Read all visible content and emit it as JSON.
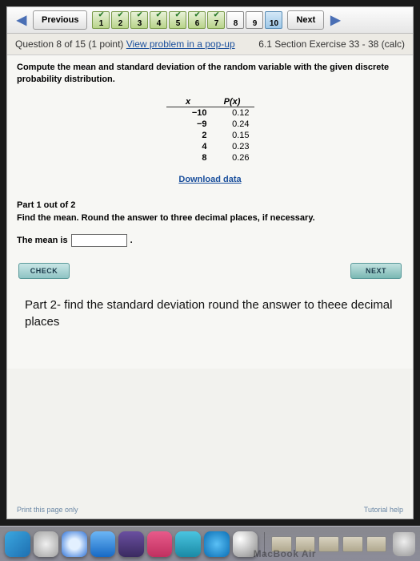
{
  "nav": {
    "prev": "Previous",
    "next": "Next",
    "items": [
      {
        "n": "1",
        "state": "done"
      },
      {
        "n": "2",
        "state": "done"
      },
      {
        "n": "3",
        "state": "done"
      },
      {
        "n": "4",
        "state": "done"
      },
      {
        "n": "5",
        "state": "done"
      },
      {
        "n": "6",
        "state": "done"
      },
      {
        "n": "7",
        "state": "done"
      },
      {
        "n": "8",
        "state": "current"
      },
      {
        "n": "9",
        "state": "plain"
      },
      {
        "n": "10",
        "state": "last"
      }
    ]
  },
  "meta": {
    "left_a": "Question 8 of 15 (1 point) ",
    "left_link": "View problem in a pop-up",
    "right": "6.1 Section Exercise 33 - 38 (calc)"
  },
  "prompt": "Compute the mean and standard deviation of the random variable with the given discrete probability distribution.",
  "dist": {
    "h1": "x",
    "h2": "P(x)",
    "rows": [
      {
        "x": "−10",
        "p": "0.12"
      },
      {
        "x": "−9",
        "p": "0.24"
      },
      {
        "x": "2",
        "p": "0.15"
      },
      {
        "x": "4",
        "p": "0.23"
      },
      {
        "x": "8",
        "p": "0.26"
      }
    ]
  },
  "download": "Download data",
  "part1": {
    "label": "Part 1 out of 2",
    "instr": "Find the mean. Round the answer to three decimal places, if necessary.",
    "ans_prefix": "The mean is",
    "btn_check": "CHECK",
    "btn_next": "NEXT"
  },
  "part2": "Part 2- find the standard deviation round the answer to theee decimal places",
  "footer": {
    "left": "Print this page only",
    "right": "Tutorial help"
  },
  "device": "MacBook Air"
}
